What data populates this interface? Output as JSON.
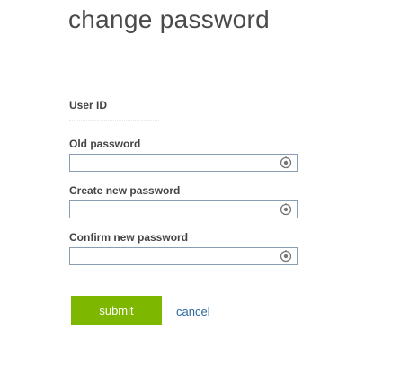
{
  "page": {
    "title": "change password"
  },
  "form": {
    "user_id_label": "User ID",
    "user_id_value": "",
    "old_password_label": "Old password",
    "old_password_value": "",
    "new_password_label": "Create new password",
    "new_password_value": "",
    "confirm_password_label": "Confirm new password",
    "confirm_password_value": "",
    "reveal_icon": "reveal-password-icon"
  },
  "actions": {
    "submit_label": "submit",
    "cancel_label": "cancel"
  },
  "colors": {
    "submit_bg": "#7db700",
    "link": "#2b6aa0",
    "field_border": "#8a9eb3"
  }
}
